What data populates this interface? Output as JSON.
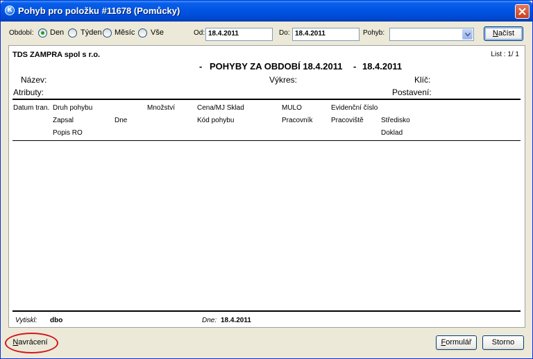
{
  "window": {
    "title": "Pohyb pro položku #11678 (Pomůcky)",
    "icon": "app-logo-icon"
  },
  "toolbar": {
    "obdobi_label": "Období:",
    "radio_den": "Den",
    "radio_tyden": "Týden",
    "radio_mesic": "Měsíc",
    "radio_vse": "Vše",
    "selected": "Den",
    "od_label": "Od:",
    "od_value": "18.4.2011",
    "do_label": "Do:",
    "do_value": "18.4.2011",
    "pohyb_label": "Pohyb:",
    "pohyb_value": "",
    "load_button_prefix": "",
    "load_button_key": "N",
    "load_button_rest": "ačíst"
  },
  "report": {
    "company": "TDS ZAMPRA spol s r.o.",
    "page_info": "List : 1/ 1",
    "heading_dash1": "-",
    "heading": "POHYBY ZA OBDOBÍ 18.4.2011",
    "heading_dash2": "-",
    "heading_date2": "18.4.2011",
    "nazev": "Název:",
    "vykres": "Výkres:",
    "klic": "Klíč:",
    "atributy": "Atributy:",
    "postaveni": "Postavení:",
    "columns_row1": [
      "Datum tran.",
      "Druh pohybu",
      "Množství",
      "Cena/MJ Sklad",
      "MULO",
      "Evidenční číslo"
    ],
    "columns_row2": [
      "Zapsal",
      "Dne",
      "Kód pohybu",
      "Pracovník",
      "Pracoviště",
      "Středisko"
    ],
    "columns_row3": [
      "Popis RO",
      "Doklad"
    ],
    "footer": {
      "printed_label": "Vytiskl:",
      "printed_value": "dbo",
      "date_label": "Dne:",
      "date_value": "18.4.2011"
    }
  },
  "buttons": {
    "back_key": "N",
    "back_rest": "avrácení",
    "form_key": "F",
    "form_rest": "ormulář",
    "cancel": "Storno"
  },
  "colors": {
    "titlebar": "#0054e3",
    "highlight_circle": "#d4151a",
    "dialog_bg": "#ece9d8"
  }
}
